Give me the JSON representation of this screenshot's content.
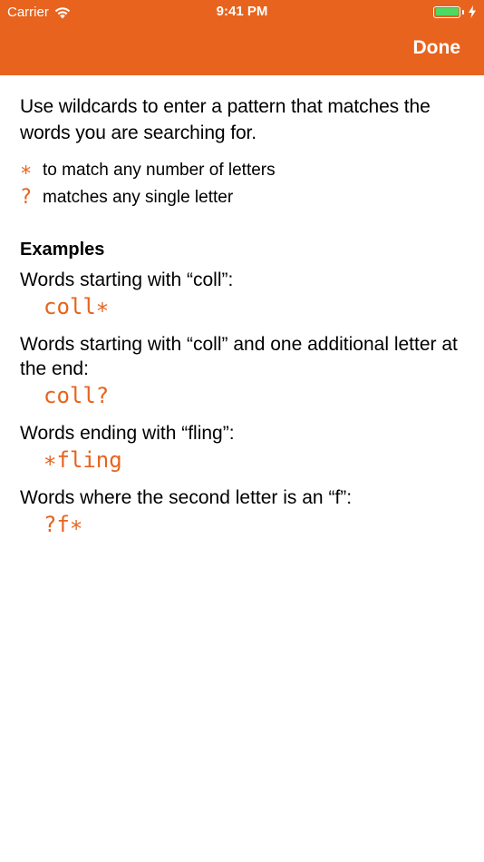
{
  "status_bar": {
    "carrier": "Carrier",
    "time": "9:41 PM",
    "battery_level": 1.0
  },
  "nav": {
    "done_label": "Done"
  },
  "colors": {
    "accent": "#e8631e",
    "battery": "#4cd964"
  },
  "intro": "Use wildcards to enter a pattern that matches the words you are searching for.",
  "legend": [
    {
      "symbol": "∗",
      "text": "to match any number of letters"
    },
    {
      "symbol": "?",
      "text": "matches any single letter"
    }
  ],
  "examples_heading": "Examples",
  "examples": [
    {
      "description": "Words starting with “coll”:",
      "pattern": "coll∗"
    },
    {
      "description": "Words starting with “coll” and one additional letter at the end:",
      "pattern": "coll?"
    },
    {
      "description": "Words ending with “fling”:",
      "pattern": "∗fling"
    },
    {
      "description": "Words where the second letter is an “f”:",
      "pattern": "?f∗"
    }
  ]
}
